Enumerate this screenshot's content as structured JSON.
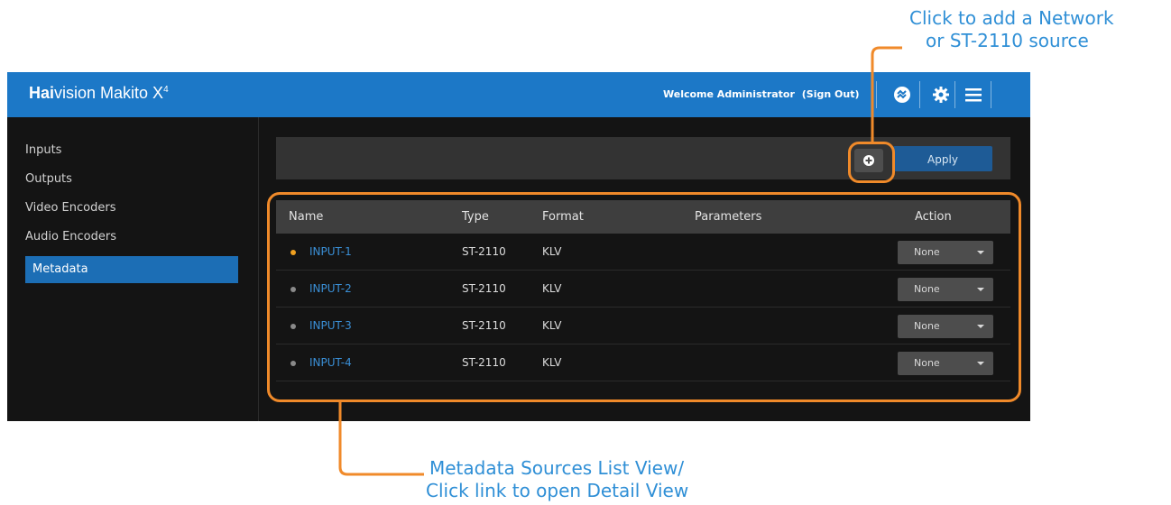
{
  "callouts": {
    "add_source_line1": "Click to add a Network",
    "add_source_line2": "or ST-2110 source",
    "list_view_line1": "Metadata Sources List View/",
    "list_view_line2": "Click link to open Detail View"
  },
  "header": {
    "brand_bold": "Hai",
    "brand_rest": "vision Makito X",
    "brand_sup": "4",
    "welcome": "Welcome Administrator",
    "sign_out": "(Sign Out)",
    "icons": [
      "haivision-logo-icon",
      "gear-icon",
      "hamburger-menu-icon"
    ]
  },
  "sidebar": {
    "items": [
      {
        "label": "Inputs",
        "active": false
      },
      {
        "label": "Outputs",
        "active": false
      },
      {
        "label": "Video Encoders",
        "active": false
      },
      {
        "label": "Audio Encoders",
        "active": false
      },
      {
        "label": "Metadata",
        "active": true
      }
    ]
  },
  "toolbar": {
    "add_icon": "plus-circle-icon",
    "apply_label": "Apply"
  },
  "table": {
    "columns": [
      "Name",
      "Type",
      "Format",
      "Parameters",
      "Action"
    ],
    "rows": [
      {
        "status": "orange",
        "name": "INPUT-1",
        "type": "ST-2110",
        "format": "KLV",
        "parameters": "",
        "action": "None"
      },
      {
        "status": "gray",
        "name": "INPUT-2",
        "type": "ST-2110",
        "format": "KLV",
        "parameters": "",
        "action": "None"
      },
      {
        "status": "gray",
        "name": "INPUT-3",
        "type": "ST-2110",
        "format": "KLV",
        "parameters": "",
        "action": "None"
      },
      {
        "status": "gray",
        "name": "INPUT-4",
        "type": "ST-2110",
        "format": "KLV",
        "parameters": "",
        "action": "None"
      }
    ]
  },
  "colors": {
    "header_blue": "#1c78c7",
    "active_blue": "#1c6eb5",
    "link_blue": "#3a8fd6",
    "callout_blue": "#2f8fd6",
    "highlight_orange": "#f08a2a",
    "status_orange": "#f0a020",
    "status_gray": "#8a8a8a"
  }
}
